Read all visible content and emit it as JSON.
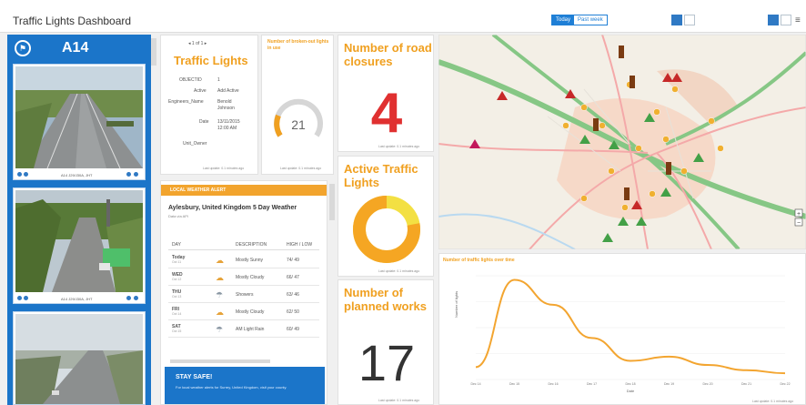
{
  "header": {
    "title": "Traffic Lights Dashboard",
    "segments": [
      "Today",
      "Past week"
    ]
  },
  "cameras": {
    "title": "A14",
    "items": [
      {
        "caption": "A14 J29/J30A, JHT"
      },
      {
        "caption": "A14 J29/J30A, JHT"
      },
      {
        "caption": ""
      }
    ]
  },
  "traffic_lights": {
    "nav": "1 of 1",
    "title": "Traffic Lights",
    "fields": [
      {
        "key": "OBJECTID",
        "value": "1"
      },
      {
        "key": "Active",
        "value": "Add Active"
      },
      {
        "key": "Engineers_Name",
        "value": "Benold Johnson"
      },
      {
        "key": "Date",
        "value": "13/11/2015 12:00 AM"
      },
      {
        "key": "Unit_Owner",
        "value": ""
      }
    ],
    "updated": "Last update: 0.1 minutes ago"
  },
  "gauge": {
    "title": "Number of broken-out lights in use",
    "value": "21",
    "updated": "Last update: 0.1 minutes ago"
  },
  "road_closures": {
    "title": "Number of road closures",
    "value": "4",
    "updated": "Last update: 0.1 minutes ago"
  },
  "active_lights": {
    "title": "Active Traffic Lights",
    "share_active": 0.78,
    "updated": "Last update: 0.1 minutes ago"
  },
  "planned_works": {
    "title": "Number of planned works",
    "value": "17",
    "updated": "Last update: 0.1 minutes ago"
  },
  "weather": {
    "alert": "LOCAL WEATHER ALERT",
    "title": "Aylesbury, United Kingdom 5 Day Weather",
    "subtitle": "Data via API",
    "columns": [
      "DAY",
      "DESCRIPTION",
      "HIGH / LOW"
    ],
    "rows": [
      {
        "day": "Today",
        "date": "Oct 11",
        "icon": "partly-sunny",
        "desc": "Mostly Sunny",
        "temp": "74/ 49"
      },
      {
        "day": "WED",
        "date": "Oct 12",
        "icon": "cloud",
        "desc": "Mostly Cloudy",
        "temp": "66/ 47"
      },
      {
        "day": "THU",
        "date": "Oct 13",
        "icon": "cloud-rain",
        "desc": "Showers",
        "temp": "63/ 46"
      },
      {
        "day": "FRI",
        "date": "Oct 14",
        "icon": "cloud",
        "desc": "Mostly Cloudy",
        "temp": "62/ 50"
      },
      {
        "day": "SAT",
        "date": "Oct 15",
        "icon": "cloud-rain",
        "desc": "AM Light Rain",
        "temp": "60/ 49"
      }
    ],
    "stay_title": "STAY SAFE!",
    "stay_text": "For local weather alerts for Surrey, United Kingdom, visit your county."
  },
  "chart_data": {
    "type": "line",
    "title": "Number of traffic lights over time",
    "xlabel": "Date",
    "ylabel": "Number of lights",
    "categories": [
      "Dec 14",
      "Dec 15",
      "Dec 16",
      "Dec 17",
      "Dec 18",
      "Dec 19",
      "Dec 20",
      "Dec 21",
      "Dec 22"
    ],
    "series": [
      {
        "values": [
          12,
          96,
          72,
          40,
          18,
          22,
          14,
          9,
          6
        ]
      }
    ],
    "ylim": [
      0,
      100
    ],
    "updated": "Last update: 0.1 minutes ago",
    "line_color": "#f3a530"
  },
  "colors": {
    "accent": "#f0a020",
    "blue": "#1b75c9",
    "red": "#e03030",
    "donut_active": "#f5a623",
    "donut_other": "#f3e043"
  }
}
